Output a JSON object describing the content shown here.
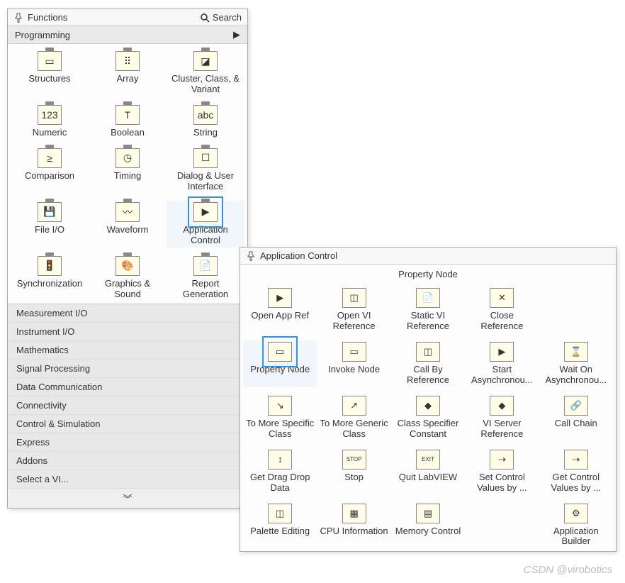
{
  "main": {
    "title": "Functions",
    "search_label": "Search",
    "category": "Programming",
    "items": [
      {
        "label": "Structures",
        "glyph": "▭"
      },
      {
        "label": "Array",
        "glyph": "⠿"
      },
      {
        "label": "Cluster, Class, & Variant",
        "glyph": "◪"
      },
      {
        "label": "Numeric",
        "glyph": "123"
      },
      {
        "label": "Boolean",
        "glyph": "T"
      },
      {
        "label": "String",
        "glyph": "abc"
      },
      {
        "label": "Comparison",
        "glyph": "≥"
      },
      {
        "label": "Timing",
        "glyph": "◷"
      },
      {
        "label": "Dialog & User Interface",
        "glyph": "☐"
      },
      {
        "label": "File I/O",
        "glyph": "💾"
      },
      {
        "label": "Waveform",
        "glyph": "〰"
      },
      {
        "label": "Application Control",
        "glyph": "▶",
        "selected": true
      },
      {
        "label": "Synchronization",
        "glyph": "🚦"
      },
      {
        "label": "Graphics & Sound",
        "glyph": "🎨"
      },
      {
        "label": "Report Generation",
        "glyph": "📄"
      }
    ],
    "other_categories": [
      "Measurement I/O",
      "Instrument I/O",
      "Mathematics",
      "Signal Processing",
      "Data Communication",
      "Connectivity",
      "Control & Simulation",
      "Express",
      "Addons",
      "Select a VI..."
    ]
  },
  "sub": {
    "title": "Application Control",
    "heading": "Property Node",
    "items": [
      {
        "label": "Open App Ref",
        "glyph": "▶"
      },
      {
        "label": "Open VI Reference",
        "glyph": "◫"
      },
      {
        "label": "Static VI Reference",
        "glyph": "📄"
      },
      {
        "label": "Close Reference",
        "glyph": "✕"
      },
      {
        "label": "",
        "glyph": ""
      },
      {
        "label": "Property Node",
        "glyph": "▭",
        "selected": true
      },
      {
        "label": "Invoke Node",
        "glyph": "▭"
      },
      {
        "label": "Call By Reference",
        "glyph": "◫"
      },
      {
        "label": "Start Asynchronou...",
        "glyph": "▶"
      },
      {
        "label": "Wait On Asynchronou...",
        "glyph": "⌛"
      },
      {
        "label": "To More Specific Class",
        "glyph": "↘"
      },
      {
        "label": "To More Generic Class",
        "glyph": "↗"
      },
      {
        "label": "Class Specifier Constant",
        "glyph": "◆"
      },
      {
        "label": "VI Server Reference",
        "glyph": "◆"
      },
      {
        "label": "Call Chain",
        "glyph": "🔗"
      },
      {
        "label": "Get Drag Drop Data",
        "glyph": "↕"
      },
      {
        "label": "Stop",
        "glyph": "STOP"
      },
      {
        "label": "Quit LabVIEW",
        "glyph": "EXIT"
      },
      {
        "label": "Set Control Values by ...",
        "glyph": "⇢"
      },
      {
        "label": "Get Control Values by ...",
        "glyph": "⇢"
      },
      {
        "label": "Palette Editing",
        "glyph": "◫"
      },
      {
        "label": "CPU Information",
        "glyph": "▦"
      },
      {
        "label": "Memory Control",
        "glyph": "▤"
      },
      {
        "label": "",
        "glyph": ""
      },
      {
        "label": "Application Builder",
        "glyph": "⚙"
      }
    ]
  },
  "watermark": "CSDN @virobotics"
}
